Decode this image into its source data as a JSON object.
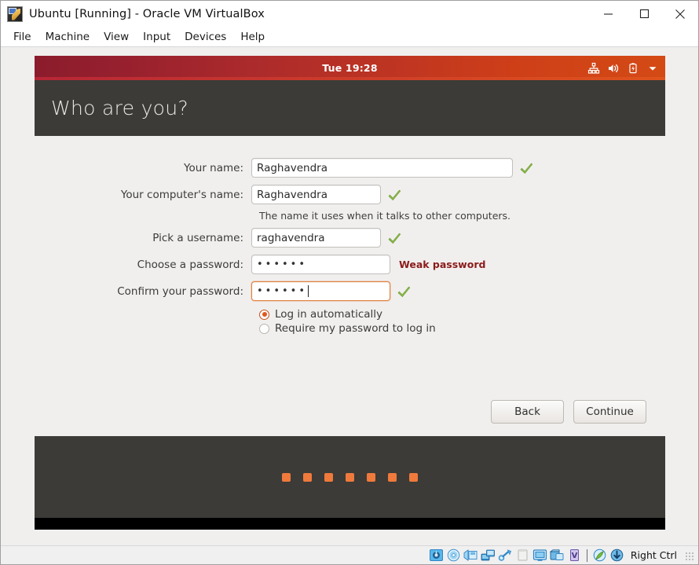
{
  "window": {
    "title": "Ubuntu [Running] - Oracle VM VirtualBox",
    "logo_icon": "virtualbox-logo-icon",
    "controls": {
      "minimize": "minimize-icon",
      "maximize": "maximize-icon",
      "close": "close-icon"
    }
  },
  "menubar": {
    "items": [
      {
        "label": "File"
      },
      {
        "label": "Machine"
      },
      {
        "label": "View"
      },
      {
        "label": "Input"
      },
      {
        "label": "Devices"
      },
      {
        "label": "Help"
      }
    ]
  },
  "ubuntu_panel": {
    "clock": "Tue 19:28",
    "indicators": [
      {
        "name": "network-icon"
      },
      {
        "name": "volume-icon"
      },
      {
        "name": "battery-icon"
      },
      {
        "name": "chevron-down-icon"
      }
    ]
  },
  "installer": {
    "page_title": "Who are you?",
    "fields": [
      {
        "label": "Your name:",
        "value": "Raghavendra",
        "placeholder": "",
        "status": "valid",
        "status_icon": "green-check-icon"
      },
      {
        "label": "Your computer's name:",
        "value": "Raghavendra",
        "placeholder": "",
        "status": "valid",
        "status_icon": "green-check-icon"
      },
      {
        "label": "Pick a username:",
        "value": "raghavendra",
        "placeholder": "",
        "status": "valid",
        "status_icon": "green-check-icon"
      },
      {
        "label": "Choose a password:",
        "value": "••••••",
        "placeholder": "",
        "status": "weak",
        "status_text": "Weak password"
      },
      {
        "label": "Confirm your password:",
        "value": "••••••",
        "placeholder": "",
        "status": "valid",
        "status_icon": "green-check-icon",
        "focused": true
      }
    ],
    "hostname_hint": "The name it uses when it talks to other computers.",
    "login_options": [
      {
        "label": "Log in automatically",
        "selected": true
      },
      {
        "label": "Require my password to log in",
        "selected": false
      }
    ],
    "buttons": {
      "back": "Back",
      "continue": "Continue"
    },
    "slideshow_dots": 7
  },
  "statusbar": {
    "icons": [
      {
        "name": "hard-disk-icon"
      },
      {
        "name": "optical-disk-icon"
      },
      {
        "name": "floppy-disk-icon"
      },
      {
        "name": "network-adapter-icon"
      },
      {
        "name": "usb-icon"
      },
      {
        "name": "shared-folders-icon"
      },
      {
        "name": "display-icon"
      },
      {
        "name": "shared-clipboard-icon"
      },
      {
        "name": "video-capture-icon"
      }
    ],
    "right_icons": [
      {
        "name": "mouse-integration-icon"
      },
      {
        "name": "host-key-icon"
      }
    ],
    "host_key": "Right Ctrl",
    "resize_grip": "resize-grip-icon"
  },
  "colors": {
    "ubuntu_orange": "#d44a15",
    "ubuntu_maroon": "#8b1c2c",
    "header_dark": "#3c3b37",
    "body_bg": "#f0efee",
    "weak_password": "#8c1a1a",
    "radio_accent": "#e2571c",
    "dot_orange": "#ef7a3c",
    "check_green": "#7fb03f"
  }
}
